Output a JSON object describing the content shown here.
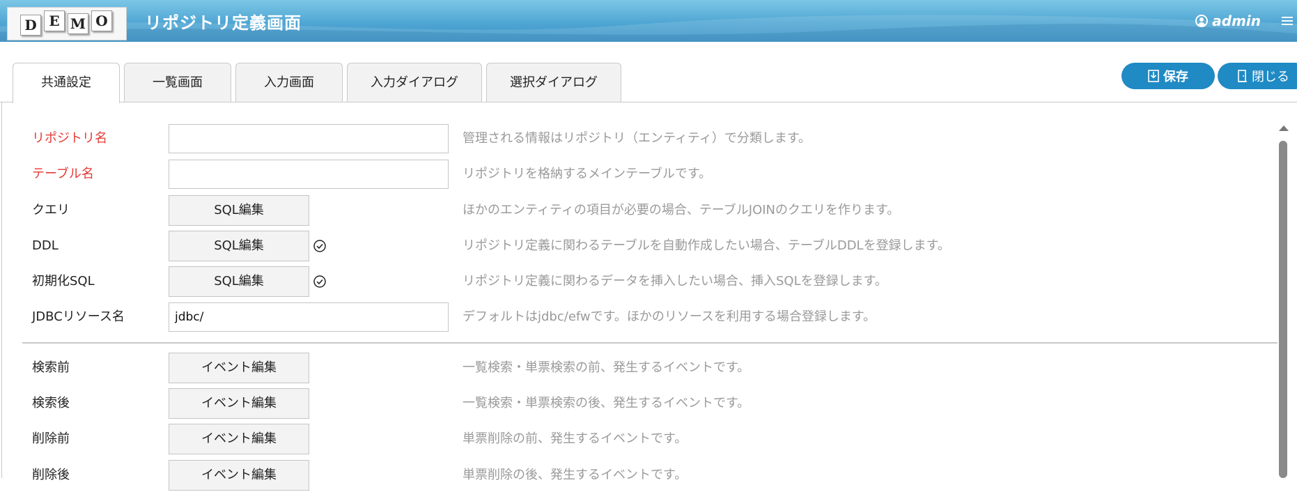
{
  "header": {
    "logo_letters": [
      "D",
      "E",
      "M",
      "O"
    ],
    "title": "リポジトリ定義画面",
    "user": "admin"
  },
  "tabs": [
    {
      "label": "共通設定",
      "active": true
    },
    {
      "label": "一覧画面",
      "active": false
    },
    {
      "label": "入力画面",
      "active": false
    },
    {
      "label": "入力ダイアログ",
      "active": false
    },
    {
      "label": "選択ダイアログ",
      "active": false
    }
  ],
  "actions": {
    "save_label": "保存",
    "close_label": "閉じる"
  },
  "form": {
    "repository_name": {
      "label": "リポジトリ名",
      "value": "",
      "description": "管理される情報はリポジトリ（エンティティ）で分類します。"
    },
    "table_name": {
      "label": "テーブル名",
      "value": "",
      "description": "リポジトリを格納するメインテーブルです。"
    },
    "query": {
      "label": "クエリ",
      "button": "SQL編集",
      "description": "ほかのエンティティの項目が必要の場合、テーブルJOINのクエリを作ります。"
    },
    "ddl": {
      "label": "DDL",
      "button": "SQL編集",
      "description": "リポジトリ定義に関わるテーブルを自動作成したい場合、テーブルDDLを登録します。"
    },
    "init_sql": {
      "label": "初期化SQL",
      "button": "SQL編集",
      "description": "リポジトリ定義に関わるデータを挿入したい場合、挿入SQLを登録します。"
    },
    "jdbc": {
      "label": "JDBCリソース名",
      "value": "jdbc/",
      "description": "デフォルトはjdbc/efwです。ほかのリソースを利用する場合登録します。"
    },
    "before_search": {
      "label": "検索前",
      "button": "イベント編集",
      "description": "一覧検索・単票検索の前、発生するイベントです。"
    },
    "after_search": {
      "label": "検索後",
      "button": "イベント編集",
      "description": "一覧検索・単票検索の後、発生するイベントです。"
    },
    "before_delete": {
      "label": "削除前",
      "button": "イベント編集",
      "description": "単票削除の前、発生するイベントです。"
    },
    "after_delete": {
      "label": "削除後",
      "button": "イベント編集",
      "description": "単票削除の後、発生するイベントです。"
    }
  },
  "colors": {
    "accent": "#1f8ac4",
    "required_label": "#e53935",
    "description": "#9a9a9a"
  }
}
